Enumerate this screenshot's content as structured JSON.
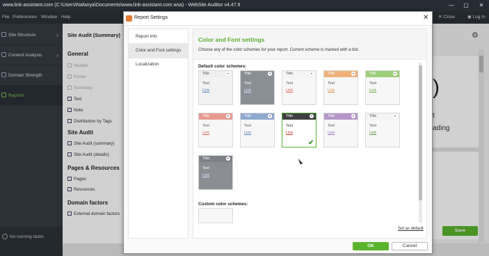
{
  "window": {
    "title": "www.link-assistant.com (C:\\Users\\Nafanya\\Documents\\www.link-assistant.com.wsa) - WebSite Auditor v4.47.9",
    "controls": [
      "—",
      "▢",
      "✕"
    ]
  },
  "menu": {
    "items": [
      "File",
      "Preferences",
      "Window",
      "Help"
    ],
    "right_items": [
      "Close",
      "Log In"
    ]
  },
  "sidebar": {
    "items": [
      {
        "label": "Site Structure",
        "icon": "sitemap-icon"
      },
      {
        "label": "Content Analysis",
        "icon": "content-icon"
      },
      {
        "label": "Domain Strength",
        "icon": "globe-icon"
      },
      {
        "label": "Reports",
        "icon": "reports-icon"
      }
    ],
    "status": "No running tasks"
  },
  "left_panel": {
    "title": "Site Audit (Summary)",
    "sections": [
      {
        "title": "General",
        "items": [
          {
            "label": "Header",
            "state": "disabled"
          },
          {
            "label": "Footer",
            "state": "disabled"
          },
          {
            "label": "Summary",
            "state": "disabled"
          },
          {
            "label": "Text",
            "state": "on"
          },
          {
            "label": "Note",
            "state": "on"
          },
          {
            "label": "Distribution by Tags",
            "state": "on"
          }
        ]
      },
      {
        "title": "Site Audit",
        "items": [
          {
            "label": "Site Audit (summary)",
            "state": "on"
          },
          {
            "label": "Site Audit (details)",
            "state": "on"
          }
        ]
      },
      {
        "title": "Pages & Resources",
        "items": [
          {
            "label": "Pages",
            "state": "on"
          },
          {
            "label": "Resources",
            "state": "on"
          }
        ]
      },
      {
        "title": "Domain factors",
        "items": [
          {
            "label": "External domain factors",
            "state": "on"
          }
        ]
      }
    ]
  },
  "right_panel": {
    "preview_char": ")",
    "preview_lines": [
      "t",
      "ading"
    ],
    "save_label": "Save"
  },
  "dialog": {
    "title": "Report Settings",
    "nav": [
      "Report info",
      "Color and Font settings",
      "Localization"
    ],
    "selected_nav": "Color and Font settings",
    "heading": "Color and Font settings",
    "description": "Choose any of the color schemes for your report. Current scheme is marked with a tick.",
    "default_label": "Default color schemes:",
    "custom_label": "Custom color schemes:",
    "set_default": "Set as default",
    "ok": "OK",
    "cancel": "Cancel",
    "schemes": [
      {
        "title": "Title",
        "text": "Text",
        "link": "Link",
        "bar": "#eeeeee",
        "title_color": "#555555",
        "bg": "#f2f2f2",
        "text_color": "#555555",
        "link_color": "#4a7fc0",
        "selected": false
      },
      {
        "title": "Title",
        "text": "Text",
        "link": "Link",
        "bar": "#8a8f96",
        "title_color": "#ffffff",
        "bg": "#8a8f96",
        "text_color": "#ffffff",
        "link_color": "#dde6ff",
        "selected": false
      },
      {
        "title": "Title",
        "text": "Text",
        "link": "Link",
        "bar": "#f4f4f4",
        "title_color": "#555555",
        "bg": "#f7f7f7",
        "text_color": "#555555",
        "link_color": "#e05c4a",
        "selected": false
      },
      {
        "title": "Title",
        "text": "Text",
        "link": "Link",
        "bar": "#f0b27a",
        "title_color": "#ffffff",
        "bg": "#f7f7f7",
        "text_color": "#555555",
        "link_color": "#e08a3c",
        "selected": false
      },
      {
        "title": "Title",
        "text": "Text",
        "link": "Link",
        "bar": "#9ccf7a",
        "title_color": "#ffffff",
        "bg": "#f7f7f7",
        "text_color": "#555555",
        "link_color": "#5fa13a",
        "selected": false
      },
      {
        "title": "Title",
        "text": "Text",
        "link": "Link",
        "bar": "#e89a92",
        "title_color": "#ffffff",
        "bg": "#f7f7f7",
        "text_color": "#555555",
        "link_color": "#d9695c",
        "selected": false
      },
      {
        "title": "Title",
        "text": "Text",
        "link": "Link",
        "bar": "#8fa9cf",
        "title_color": "#ffffff",
        "bg": "#f7f7f7",
        "text_color": "#555555",
        "link_color": "#5a7fb8",
        "selected": false
      },
      {
        "title": "Title",
        "text": "Text",
        "link": "Link",
        "bar": "#3f4042",
        "title_color": "#ffffff",
        "bg": "#ffffff",
        "text_color": "#333333",
        "link_color": "#c0392b",
        "selected": true
      },
      {
        "title": "Title",
        "text": "Text",
        "link": "Link",
        "bar": "#b497c8",
        "title_color": "#ffffff",
        "bg": "#f7f7f7",
        "text_color": "#555555",
        "link_color": "#9a6fb8",
        "selected": false
      },
      {
        "title": "Title",
        "text": "Text",
        "link": "Link",
        "bar": "#f4f4f4",
        "title_color": "#555555",
        "bg": "#f7f7f7",
        "text_color": "#555555",
        "link_color": "#5a8e3a",
        "selected": false
      },
      {
        "title": "Title",
        "text": "Text",
        "link": "Link",
        "bar": "#7e8287",
        "title_color": "#ffffff",
        "bg": "#8a8e93",
        "text_color": "#ffffff",
        "link_color": "#dfe8ff",
        "selected": false
      }
    ]
  },
  "colors": {
    "accent_green": "#5ab52e",
    "heading_green": "#58b02f",
    "sidebar_bg": "#353c44"
  }
}
